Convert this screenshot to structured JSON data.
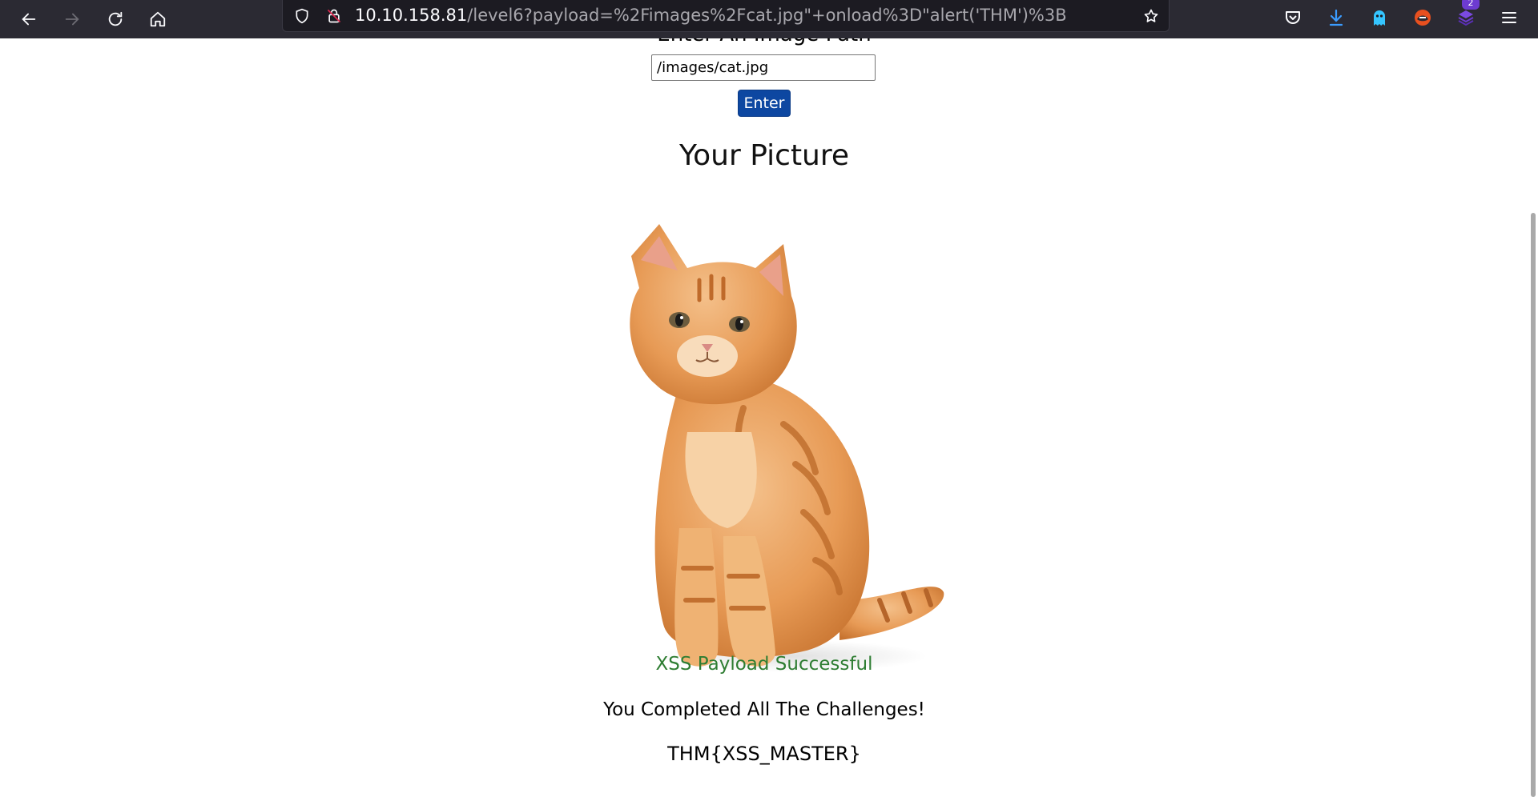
{
  "browser": {
    "url_host": "10.10.158.81",
    "url_path": "/level6?payload=%2Fimages%2Fcat.jpg\"+onload%3D\"alert('THM')%3B",
    "extension_badge": "2"
  },
  "page": {
    "input_label": "Enter An Image Path",
    "path_input_value": "/images/cat.jpg",
    "enter_button": "Enter",
    "heading": "Your Picture",
    "success_message": "XSS Payload Successful",
    "completed_message": "You Completed All The Challenges!",
    "flag": "THM{XSS_MASTER}"
  },
  "colors": {
    "toolbar_bg": "#2b2a33",
    "button_bg": "#0d47a1",
    "success_text": "#2e7d32"
  }
}
